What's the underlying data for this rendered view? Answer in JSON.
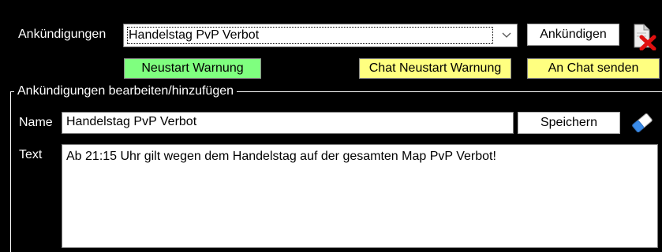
{
  "announcements": {
    "label": "Ankündigungen",
    "selected": "Handelstag PvP Verbot",
    "announce_button": "Ankündigen",
    "delete_icon": "delete-announcement-icon"
  },
  "buttons": {
    "restart_warning": "Neustart Warnung",
    "chat_restart_warning": "Chat Neustart Warnung",
    "send_to_chat": "An Chat senden"
  },
  "edit_group": {
    "legend": "Ankündigungen bearbeiten/hinzufügen",
    "name_label": "Name",
    "name_value": "Handelstag PvP Verbot",
    "save_button": "Speichern",
    "eraser_icon": "eraser-icon",
    "text_label": "Text",
    "text_value": "Ab 21:15 Uhr gilt wegen dem Handelstag auf der gesamten Map PvP Verbot!"
  },
  "colors": {
    "background": "#000000",
    "green_button": "#7fff7f",
    "yellow_button": "#ffff80"
  }
}
